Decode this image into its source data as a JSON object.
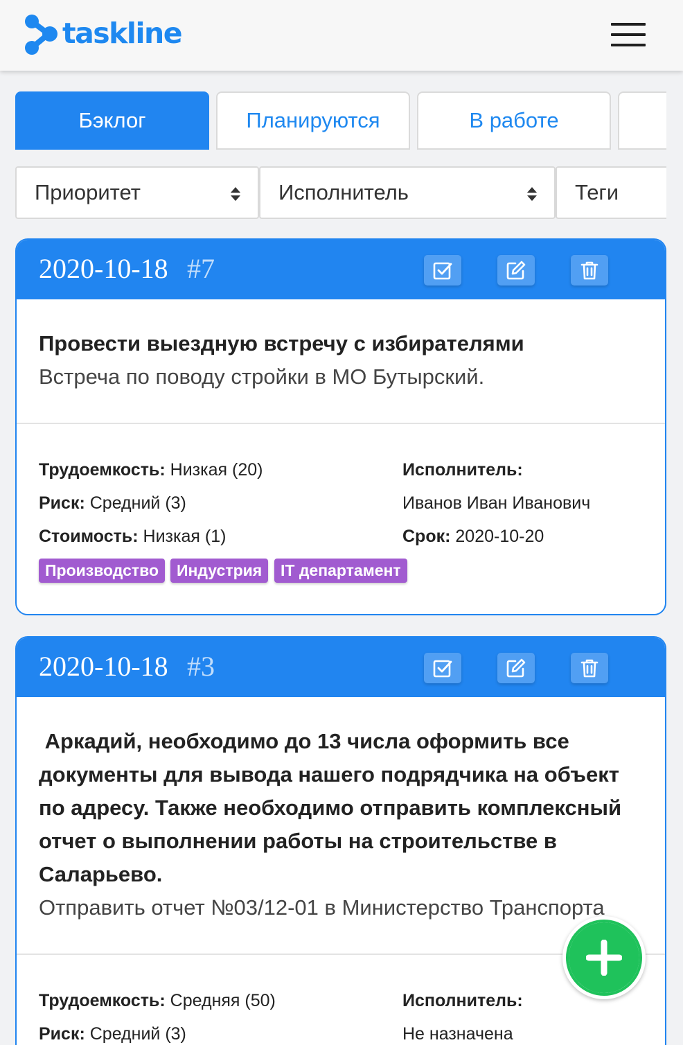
{
  "app": {
    "brand": "taskline",
    "brand_color": "#1e88f0",
    "accent_color": "#2185f0",
    "tag_color": "#a15bd0",
    "fab_color": "#1fc25b"
  },
  "tabs": [
    {
      "label": "Бэклог",
      "active": true
    },
    {
      "label": "Планируются",
      "active": false
    },
    {
      "label": "В работе",
      "active": false
    }
  ],
  "filters": [
    {
      "label": "Приоритет",
      "icon": "sort-caret-icon"
    },
    {
      "label": "Исполнитель",
      "icon": "sort-caret-icon"
    },
    {
      "label": "Теги"
    }
  ],
  "tasks": [
    {
      "date": "2020-10-18",
      "number": "#7",
      "actions": [
        "checkbox-icon",
        "edit-icon",
        "trash-icon"
      ],
      "title": "Провести выездную встречу с избирателями",
      "description": "Встреча по поводу стройки в МО Бутырский.",
      "labor_label": "Трудоемкость:",
      "labor_value": " Низкая (20)",
      "risk_label": "Риск:",
      "risk_value": " Средний (3)",
      "cost_label": "Стоимость:",
      "cost_value": " Низкая (1)",
      "assignee_label": "Исполнитель:",
      "assignee_value": "Иванов Иван Иванович",
      "deadline_label": "Срок:",
      "deadline_value": " 2020-10-20",
      "tags": [
        "Производство",
        "Индустрия",
        "IT департамент"
      ]
    },
    {
      "date": "2020-10-18",
      "number": "#3",
      "actions": [
        "checkbox-icon",
        "edit-icon",
        "trash-icon"
      ],
      "title": " Аркадий, необходимо до 13 числа оформить все документы для вывода нашего подрядчика на объект по адресу. Также необходимо отправить комплексный отчет о выполнении работы на строительстве в Саларьево.",
      "description": "Отправить отчет №03/12-01 в Министерство Транспорта",
      "labor_label": "Трудоемкость:",
      "labor_value": " Средняя (50)",
      "risk_label": "Риск:",
      "risk_value": " Средний (3)",
      "assignee_label": "Исполнитель:",
      "assignee_value": "Не назначена"
    }
  ],
  "fab": {
    "icon": "plus-icon"
  },
  "menu": {
    "icon": "hamburger-menu-icon"
  }
}
